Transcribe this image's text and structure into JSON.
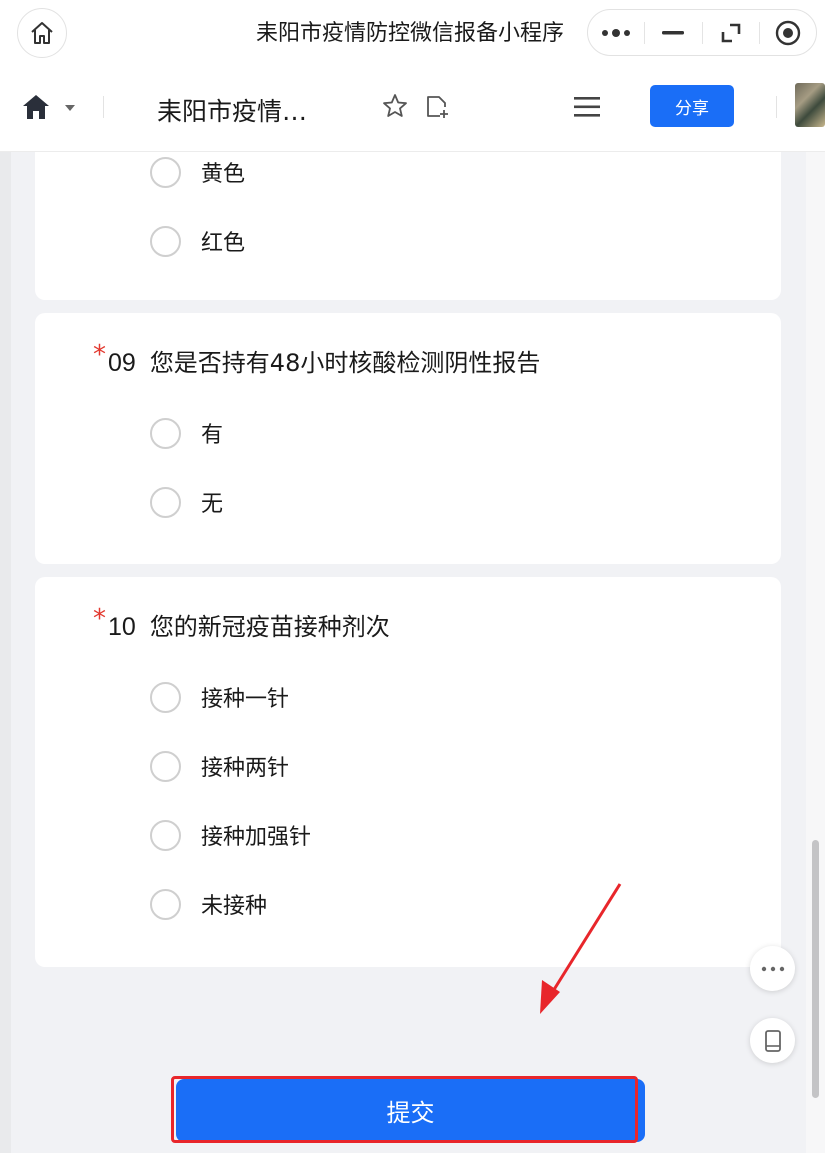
{
  "window": {
    "title": "耒阳市疫情防控微信报备小程序"
  },
  "toolbar": {
    "doc_title": "耒阳市疫情…",
    "share_label": "分享"
  },
  "cards": [
    {
      "options": [
        "黄色",
        "红色"
      ]
    },
    {
      "number": "09",
      "required_mark": "*",
      "question": "您是否持有48小时核酸检测阴性报告",
      "options": [
        "有",
        "无"
      ]
    },
    {
      "number": "10",
      "required_mark": "*",
      "question": "您的新冠疫苗接种剂次",
      "options": [
        "接种一针",
        "接种两针",
        "接种加强针",
        "未接种"
      ]
    }
  ],
  "submit": {
    "label": "提交"
  },
  "icons": {
    "window_home": "home-outline-icon",
    "capsule": [
      "more-dots-icon",
      "minimize-icon",
      "restore-icon",
      "close-circle-icon"
    ],
    "toolbar": [
      "home-filled-icon",
      "caret-down-icon",
      "star-icon",
      "add-file-icon",
      "menu-icon"
    ],
    "floating": [
      "more-horizontal-icon",
      "tablet-icon"
    ]
  },
  "colors": {
    "accent": "#1a6ef7",
    "required": "#e3392f",
    "annotation": "#e8262b"
  }
}
